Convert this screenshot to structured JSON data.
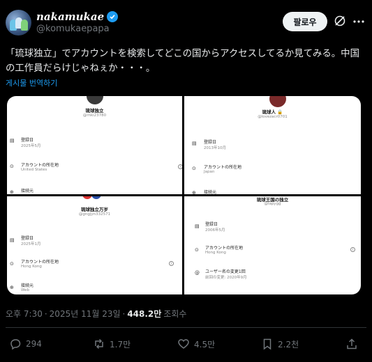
{
  "author": {
    "display_name": "nakamukae",
    "handle": "@komukaepapa",
    "verified": true
  },
  "header": {
    "follow_label": "팔로우"
  },
  "post": {
    "text": "「琉球独立」でアカウントを検索してどこの国からアクセスしてるか見てみる。中国の工作員だらけじゃねぇか・・・。",
    "translate_label": "게시물 번역하기"
  },
  "media": {
    "panels": [
      {
        "name": "琉球独立",
        "handle": "@rnki23780",
        "joined_label": "登録日",
        "joined_value": "2025年5月",
        "location_label": "アカウントの所在地",
        "location_value": "United States",
        "connected_label": "接続元"
      },
      {
        "name": "琉球人",
        "handle": "@lovezacr0701",
        "joined_label": "登録日",
        "joined_value": "2013年10月",
        "location_label": "アカウントの所在地",
        "location_value": "Japan",
        "connected_label": "接続元"
      },
      {
        "name": "琉球独立万岁",
        "handle": "@gngjyn332571",
        "joined_label": "登録日",
        "joined_value": "2025年1月",
        "location_label": "アカウントの所在地",
        "location_value": "Hong Kong",
        "connected_label": "接続元",
        "connected_value": "Web"
      },
      {
        "name": "琉球王国の独立",
        "handle": "@lapygg",
        "joined_label": "登録日",
        "joined_value": "2006年5月",
        "location_label": "アカウントの所在地",
        "location_value": "Hong Kong",
        "username_label": "ユーザー名の変更1回",
        "username_value": "前回の変更: 2020年9月"
      }
    ]
  },
  "meta": {
    "time": "오후 7:30",
    "date": "2025년 11월 23일",
    "views": "448.2만",
    "views_label": "조회수"
  },
  "actions": {
    "replies": "294",
    "reposts": "1.7만",
    "likes": "4.5만",
    "bookmarks": "2.2천"
  },
  "colors": {
    "accent": "#1d9bf0",
    "background": "#000000",
    "muted": "#71767b"
  }
}
